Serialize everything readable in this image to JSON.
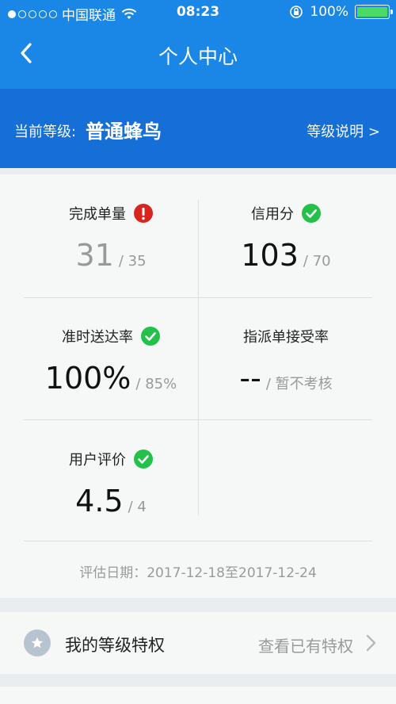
{
  "status_bar": {
    "carrier": "中国联通",
    "time": "08:23",
    "battery": "100%",
    "signal_dots_filled": 1,
    "signal_dots_total": 5
  },
  "nav": {
    "title": "个人中心",
    "back_icon": "chevron-left-icon"
  },
  "level": {
    "label": "当前等级:",
    "value": "普通蜂鸟",
    "explain": "等级说明 >"
  },
  "stats": {
    "completed": {
      "label": "完成单量",
      "status": "warning",
      "value": "31",
      "target": "/ 35"
    },
    "credit": {
      "label": "信用分",
      "status": "ok",
      "value": "103",
      "target": "/ 70"
    },
    "ontime": {
      "label": "准时送达率",
      "status": "ok",
      "value": "100%",
      "target": "/ 85%"
    },
    "assign": {
      "label": "指派单接受率",
      "value": "--",
      "target": "/ 暂不考核"
    },
    "rating": {
      "label": "用户评价",
      "status": "ok",
      "value": "4.5",
      "target": "/ 4"
    }
  },
  "eval_date": "评估日期：2017-12-18至2017-12-24",
  "privilege": {
    "title": "我的等级特权",
    "link": "查看已有特权"
  },
  "colors": {
    "header_blue": "#1a87e6",
    "level_blue": "#166fd6",
    "ok_green": "#24c14a",
    "warn_red": "#d8261e"
  }
}
